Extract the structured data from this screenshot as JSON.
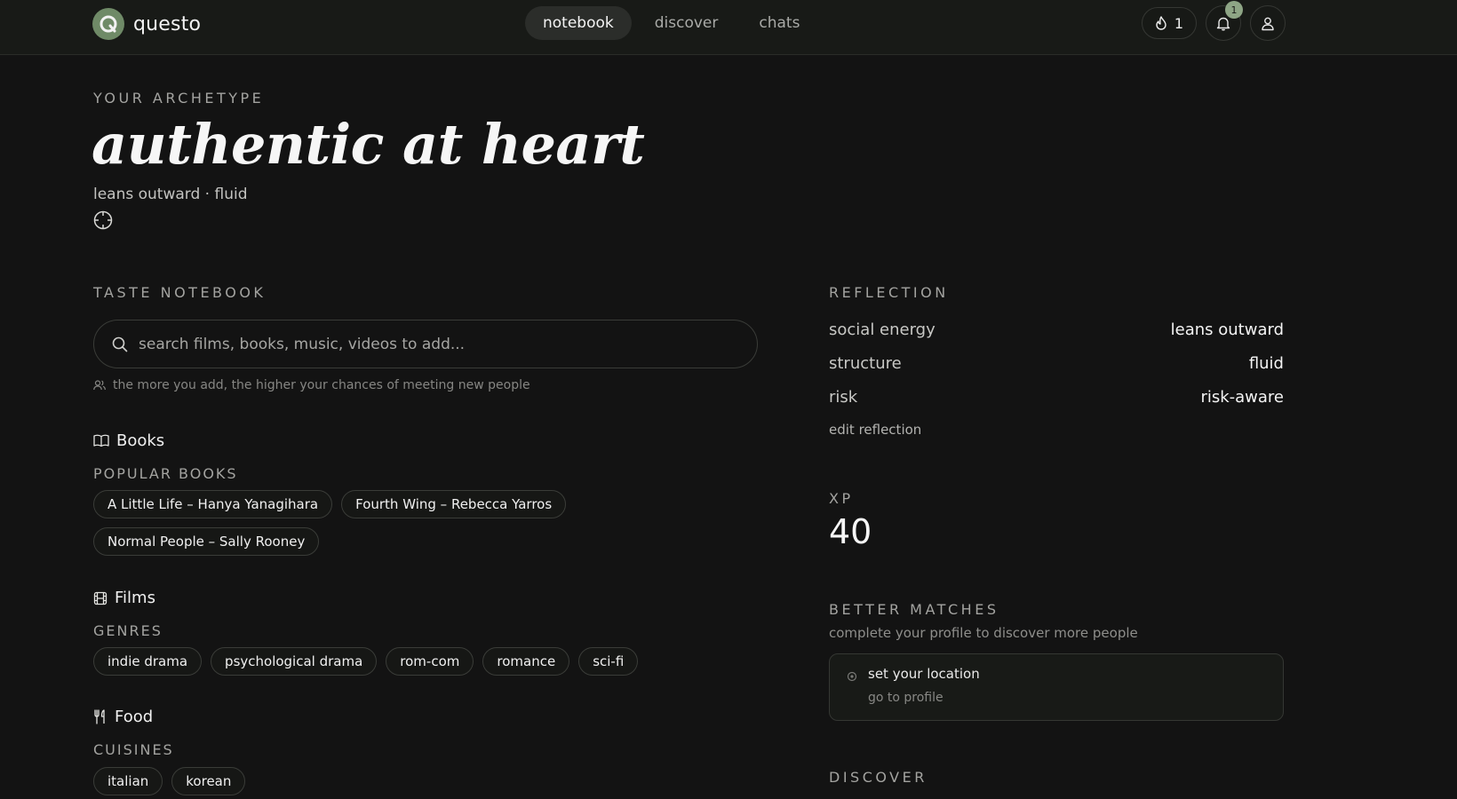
{
  "header": {
    "brand": "questo",
    "nav": [
      "notebook",
      "discover",
      "chats"
    ],
    "active_nav": "notebook",
    "streak": "1",
    "notifications": "1"
  },
  "hero": {
    "eyebrow": "YOUR ARCHETYPE",
    "title": "authentic at heart",
    "subtitle": "leans outward · fluid"
  },
  "notebook": {
    "label": "TASTE NOTEBOOK",
    "search_placeholder": "search films, books, music, videos to add...",
    "hint": "the more you add, the higher your chances of meeting new people",
    "books": {
      "title": "Books",
      "sublabel": "POPULAR BOOKS",
      "items": [
        "A Little Life – Hanya Yanagihara",
        "Fourth Wing – Rebecca Yarros",
        "Normal People – Sally Rooney"
      ]
    },
    "films": {
      "title": "Films",
      "sublabel": "GENRES",
      "items": [
        "indie drama",
        "psychological drama",
        "rom-com",
        "romance",
        "sci-fi"
      ]
    },
    "food": {
      "title": "Food",
      "sublabel": "CUISINES",
      "items": [
        "italian",
        "korean"
      ]
    }
  },
  "reflection": {
    "label": "REFLECTION",
    "rows": [
      {
        "key": "social energy",
        "value": "leans outward"
      },
      {
        "key": "structure",
        "value": "fluid"
      },
      {
        "key": "risk",
        "value": "risk-aware"
      }
    ],
    "edit": "edit reflection"
  },
  "xp": {
    "label": "XP",
    "value": "40"
  },
  "better_matches": {
    "label": "BETTER MATCHES",
    "subtitle": "complete your profile to discover more people",
    "card_title": "set your location",
    "card_link": "go to profile"
  },
  "discover": {
    "label": "DISCOVER"
  }
}
